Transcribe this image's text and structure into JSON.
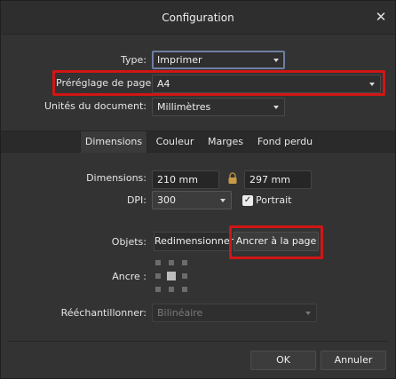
{
  "window": {
    "title": "Configuration",
    "close_glyph": "✕"
  },
  "document_settings": {
    "type_label": "Type:",
    "type_value": "Imprimer",
    "preset_label": "Préréglage de page:",
    "preset_value": "A4",
    "units_label": "Unités du document:",
    "units_value": "Millimètres"
  },
  "tabs": [
    {
      "label": "Dimensions",
      "active": true
    },
    {
      "label": "Couleur",
      "active": false
    },
    {
      "label": "Marges",
      "active": false
    },
    {
      "label": "Fond perdu",
      "active": false
    }
  ],
  "dimensions": {
    "label": "Dimensions:",
    "width": "210 mm",
    "height": "297 mm",
    "lock_icon": "lock-icon",
    "dpi_label": "DPI:",
    "dpi_value": "300",
    "portrait_label": "Portrait",
    "portrait_checked": true
  },
  "objects": {
    "label": "Objets:",
    "resize_button": "Redimensionner",
    "anchor_button": "Ancrer à la page",
    "anchor_label": "Ancre :",
    "anchor_icon": "anchor-grid-icon",
    "resample_label": "Rééchantillonner:",
    "resample_value": "Bilinéaire"
  },
  "footer": {
    "ok_label": "OK",
    "cancel_label": "Annuler"
  },
  "colors": {
    "highlight": "#d21515",
    "background": "#333333",
    "focus": "#6f7ea3"
  }
}
